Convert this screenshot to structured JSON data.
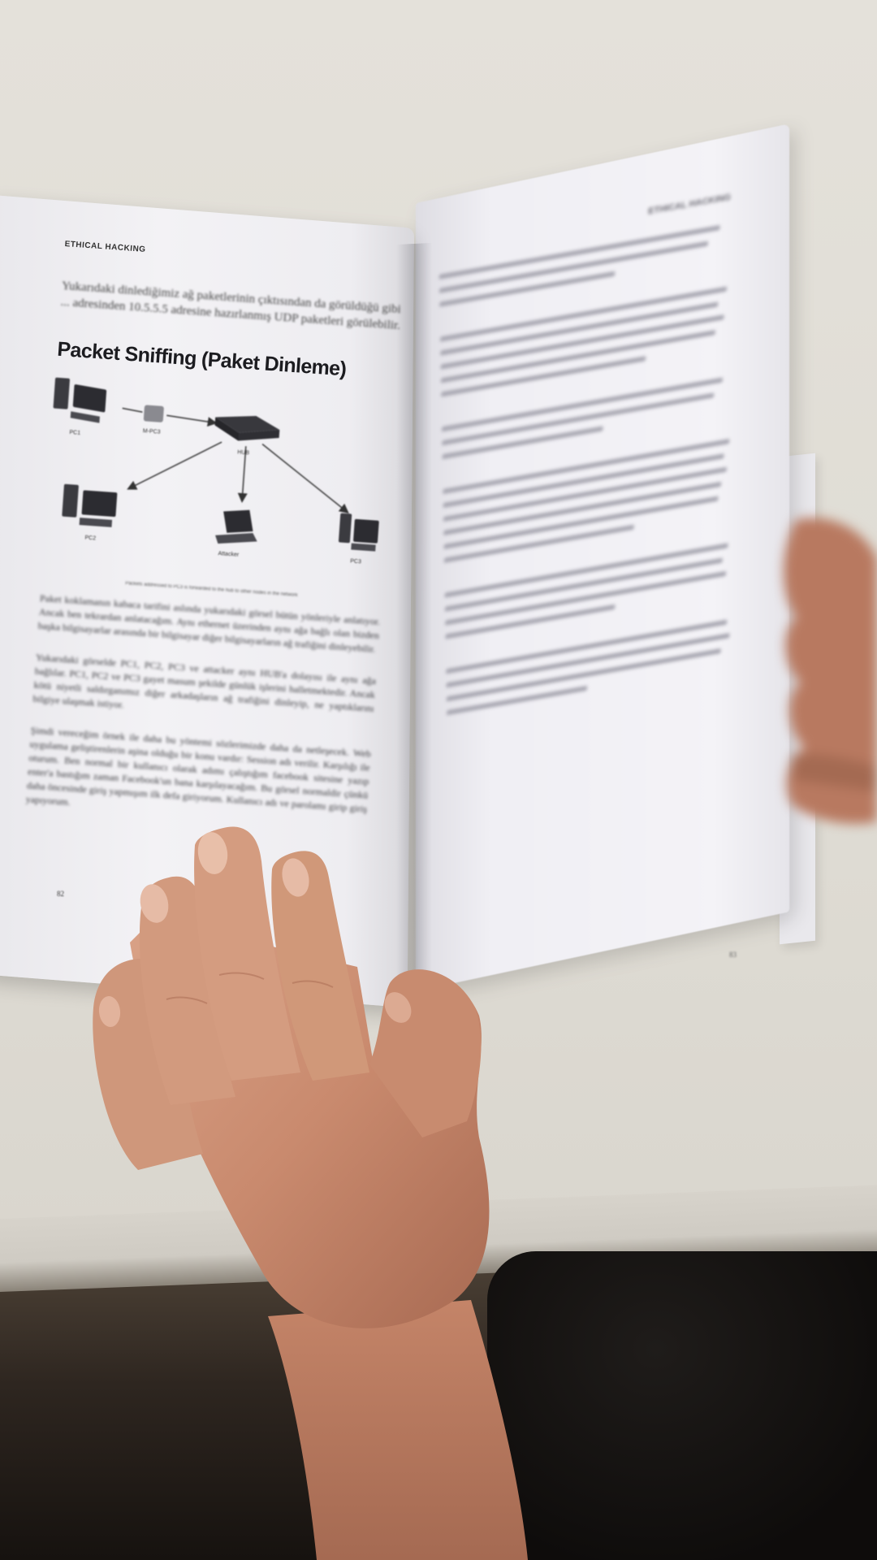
{
  "left_page": {
    "running_head": "ETHICAL HACKING",
    "intro_text": "Yukarıdaki dinlediğimiz ağ paketlerinin çıktısından da görüldüğü gibi ... adresinden 10.5.5.5 adresine hazırlanmış UDP paketleri görülebilir.",
    "section_title": "Packet Sniffing (Paket Dinleme)",
    "diagram": {
      "node_labels": [
        "PC1",
        "M-PC3",
        "HUB",
        "PC2",
        "Attacker",
        "PC3"
      ],
      "caption": "Packets addressed to PC3 is forwarded to the hub to other nodes in the network"
    },
    "paragraphs": [
      "Paket koklamanın kabaca tarifini aslında yukarıdaki görsel bütün yönleriyle anlatıyor. Ancak ben tekrardan anlatacağım. Aynı ethernet üzerinden aynı ağa bağlı olan bizden başka bilgisayarlar arasında bir bilgisayar diğer bilgisayarların ağ trafiğini dinleyebilir.",
      "Yukarıdaki görselde PC1, PC2, PC3 ve attacker aynı HUB'a dolayısı ile aynı ağa bağlılar. PC1, PC2 ve PC3 gayet masum şekilde günlük işlerini halletmektedir. Ancak kötü niyetli saldırganımız diğer arkadaşların ağ trafiğini dinleyip, ne yaptıklarını bilgiye ulaşmak istiyor.",
      "Şimdi vereceğim örnek ile daha bu yöntemi sözlerimizde daha da netleşecek. Web uygulama geliştirenlerin aşina olduğu bir konu vardır: Session adı verilir. Karşılığı ile oturum. Ben normal bir kullanıcı olarak adımı çalıştığım facebook sitesine yazıp enter'a bastığım zaman Facebook'un bana karşılayacağım. Bu görsel normaldir çünkü daha öncesinde giriş yapmışım ilk defa giriyorum. Kullanıcı adı ve parolamı girip giriş yapıyorum."
    ],
    "page_number": "82"
  },
  "right_page": {
    "running_head": "ETHICAL HACKING",
    "page_number": "83"
  }
}
